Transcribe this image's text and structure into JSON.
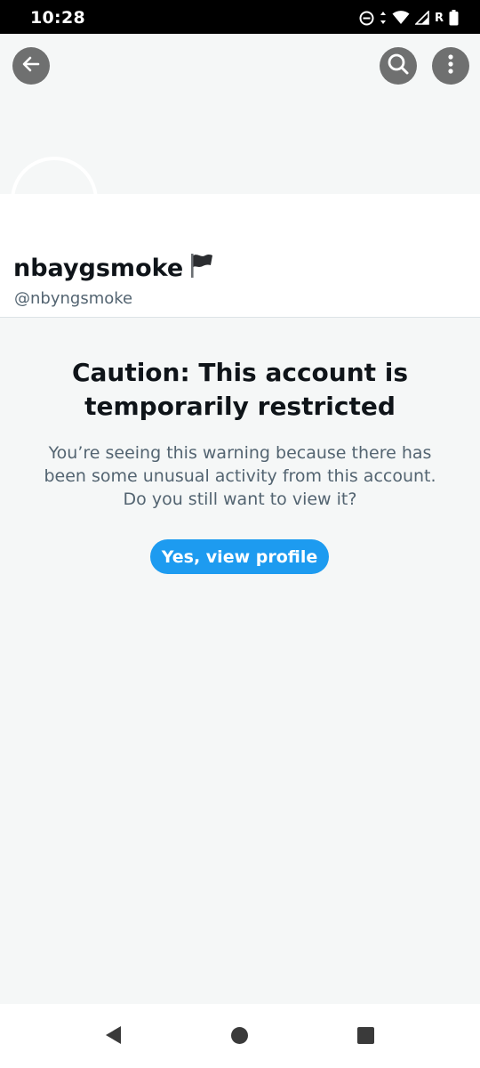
{
  "status_bar": {
    "time": "10:28",
    "icons": [
      "do-not-disturb-icon",
      "wifi-icon",
      "signal-icon",
      "battery-icon"
    ],
    "roaming_label": "R"
  },
  "header": {
    "back_icon": "arrow-left-icon",
    "search_icon": "search-icon",
    "more_icon": "more-vertical-icon"
  },
  "profile": {
    "display_name": "nbaygsmoke",
    "name_emoji": "black-flag-icon",
    "handle": "@nbyngsmoke"
  },
  "warning": {
    "title": "Caution: This account is temporarily restricted",
    "body": "You’re seeing this warning because there has been some unusual activity from this account. Do you still want to view it?",
    "button_label": "Yes, view profile"
  },
  "colors": {
    "accent": "#1d9bf0",
    "text_primary": "#0f1419",
    "text_secondary": "#536471",
    "background": "#f5f7f7"
  },
  "nav_bar": {
    "icons": [
      "nav-back-icon",
      "nav-home-icon",
      "nav-recents-icon"
    ]
  }
}
